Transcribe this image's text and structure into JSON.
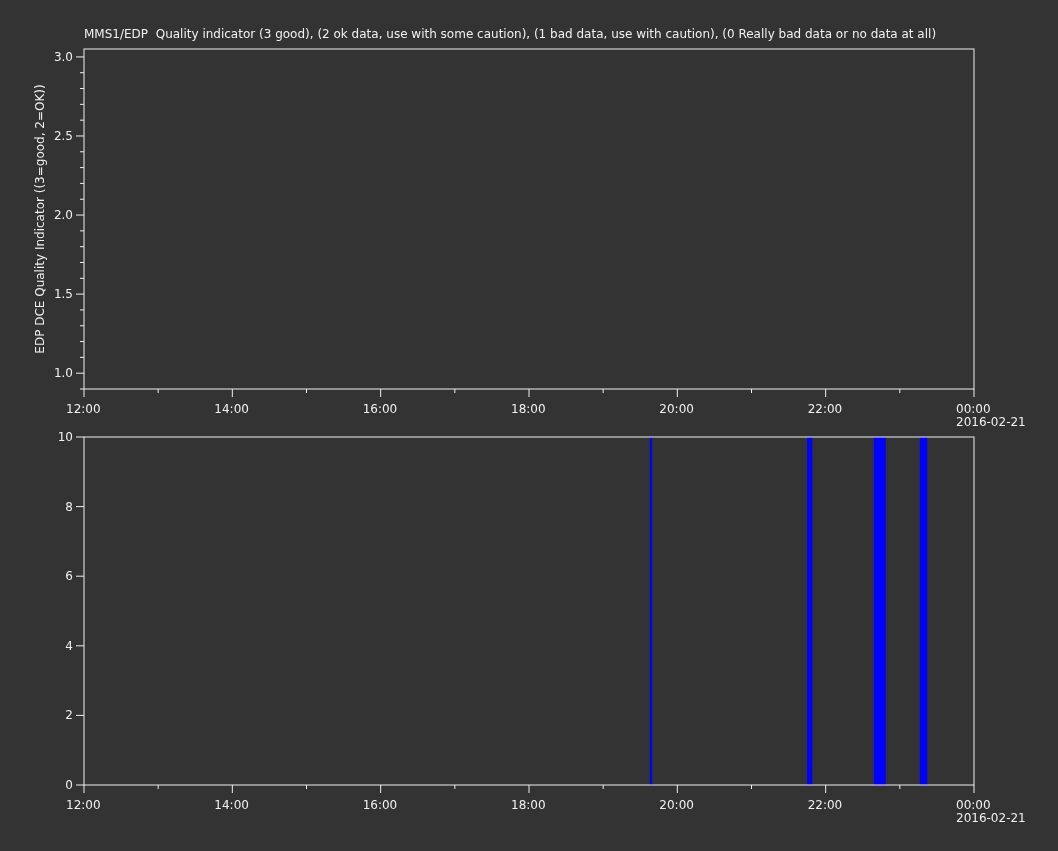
{
  "title": "MMS1/EDP  Quality indicator (3 good), (2 ok data, use with some caution), (1 bad data, use with caution), (0 Really bad data or no data at all)",
  "plots": [
    {
      "date_label": "2016-02-21",
      "chart_data": {
        "type": "line",
        "ylabel": "EDP DCE Quality Indicator ((3=good, 2=OK))",
        "xlim": [
          12,
          24
        ],
        "ylim": [
          0.9,
          3.05
        ],
        "xticks": [
          {
            "value": 12,
            "label": "12:00"
          },
          {
            "value": 14,
            "label": "14:00"
          },
          {
            "value": 16,
            "label": "16:00"
          },
          {
            "value": 18,
            "label": "18:00"
          },
          {
            "value": 20,
            "label": "20:00"
          },
          {
            "value": 22,
            "label": "22:00"
          },
          {
            "value": 24,
            "label": "00:00"
          }
        ],
        "yticks": [
          {
            "value": 1,
            "label": "1.0"
          },
          {
            "value": 1.5,
            "label": "1.5"
          },
          {
            "value": 2,
            "label": "2.0"
          },
          {
            "value": 2.5,
            "label": "2.5"
          },
          {
            "value": 3,
            "label": "3.0"
          }
        ]
      }
    },
    {
      "date_label": "2016-02-21",
      "chart_data": {
        "type": "area",
        "xlim": [
          12,
          24
        ],
        "ylim": [
          0,
          10
        ],
        "xticks": [
          {
            "value": 12,
            "label": "12:00"
          },
          {
            "value": 14,
            "label": "14:00"
          },
          {
            "value": 16,
            "label": "16:00"
          },
          {
            "value": 18,
            "label": "18:00"
          },
          {
            "value": 20,
            "label": "20:00"
          },
          {
            "value": 22,
            "label": "22:00"
          },
          {
            "value": 24,
            "label": "00:00"
          }
        ],
        "yticks": [
          0,
          2,
          4,
          6,
          8,
          10
        ],
        "x": [
          19.63,
          19.66,
          19.7,
          21.75,
          21.82,
          21.9,
          22.65,
          22.81,
          22.9,
          23.27,
          23.37
        ],
        "series": [
          {
            "color": "#0000ff",
            "values": [
              10,
              10,
              null,
              10,
              10,
              null,
              10,
              10,
              null,
              10,
              10
            ]
          }
        ]
      }
    }
  ]
}
